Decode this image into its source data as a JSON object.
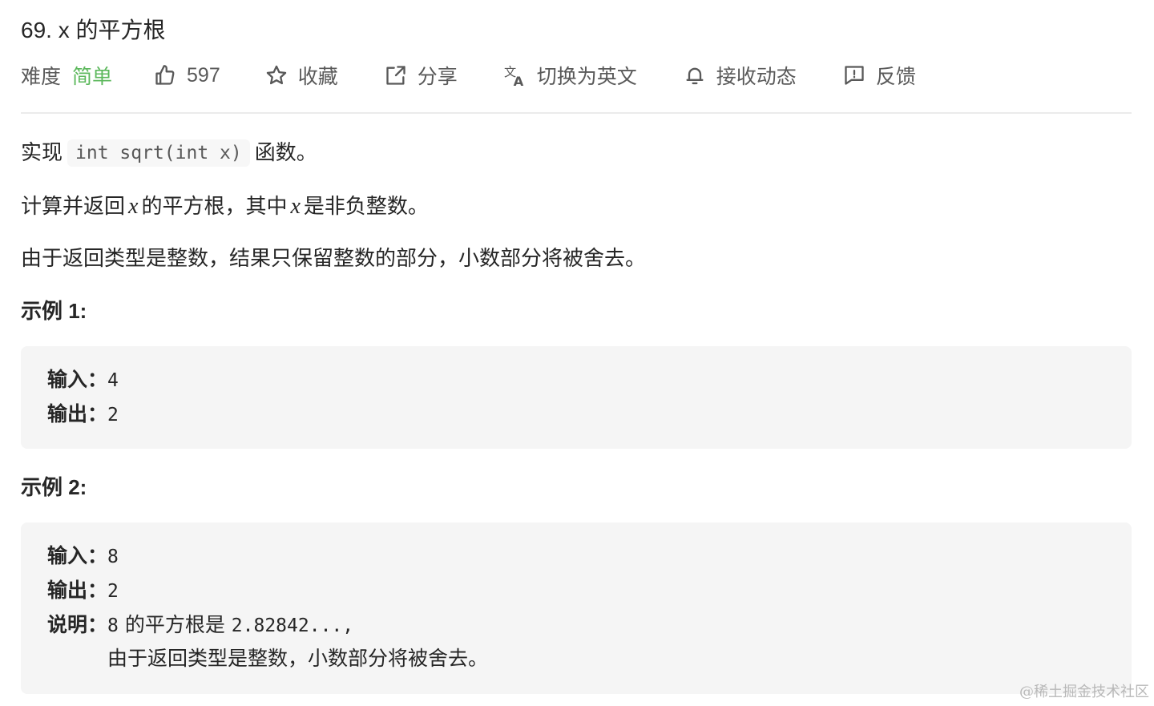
{
  "problem": {
    "title": "69. x 的平方根",
    "difficulty_label": "难度",
    "difficulty_value": "简单",
    "colors": {
      "difficulty": "#5cb85c",
      "text": "#262626",
      "muted": "#595959"
    }
  },
  "toolbar": {
    "likes_icon": "thumbs-up-icon",
    "likes_count": "597",
    "favorite_icon": "star-icon",
    "favorite_label": "收藏",
    "share_icon": "share-icon",
    "share_label": "分享",
    "translate_icon": "translate-icon",
    "translate_label": "切换为英文",
    "subscribe_icon": "bell-icon",
    "subscribe_label": "接收动态",
    "feedback_icon": "feedback-icon",
    "feedback_label": "反馈"
  },
  "description": {
    "p1_prefix": "实现",
    "p1_code": "int sqrt(int x)",
    "p1_suffix": "函数。",
    "p2_a": "计算并返回",
    "p2_var1": "x",
    "p2_b": "的平方根，其中",
    "p2_var2": "x",
    "p2_c": "是非负整数。",
    "p3": "由于返回类型是整数，结果只保留整数的部分，小数部分将被舍去。"
  },
  "examples": [
    {
      "heading": "示例 1:",
      "input_label": "输入：",
      "input_value": "4",
      "output_label": "输出：",
      "output_value": "2"
    },
    {
      "heading": "示例 2:",
      "input_label": "输入：",
      "input_value": "8",
      "output_label": "输出：",
      "output_value": "2",
      "explain_label": "说明：",
      "explain_value_num": "8",
      "explain_text": "的平方根是",
      "explain_value_num2": "2.82842...,",
      "explain_line2": "由于返回类型是整数，小数部分将被舍去。"
    }
  ],
  "watermark": "@稀土掘金技术社区"
}
